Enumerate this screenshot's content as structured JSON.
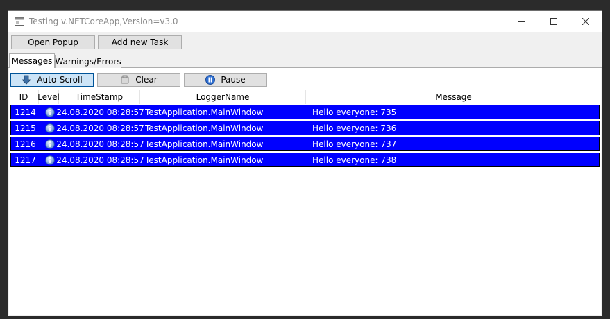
{
  "window": {
    "title": "Testing v.NETCoreApp,Version=v3.0"
  },
  "topbar": {
    "open_popup": "Open Popup",
    "add_task": "Add new Task"
  },
  "tabs": [
    {
      "label": "Messages",
      "active": true
    },
    {
      "label": "Warnings/Errors",
      "active": false
    }
  ],
  "toolbar": {
    "autoscroll": "Auto-Scroll",
    "clear": "Clear",
    "pause": "Pause"
  },
  "table": {
    "columns": [
      "ID",
      "Level",
      "TimeStamp",
      "LoggerName",
      "Message"
    ],
    "rows": [
      {
        "id": "1214",
        "level": "info-icon",
        "timestamp": "24.08.2020 08:28:57",
        "logger": "TestApplication.MainWindow",
        "message": "Hello everyone: 735"
      },
      {
        "id": "1215",
        "level": "info-icon",
        "timestamp": "24.08.2020 08:28:57",
        "logger": "TestApplication.MainWindow",
        "message": "Hello everyone: 736"
      },
      {
        "id": "1216",
        "level": "info-icon",
        "timestamp": "24.08.2020 08:28:57",
        "logger": "TestApplication.MainWindow",
        "message": "Hello everyone: 737"
      },
      {
        "id": "1217",
        "level": "info-icon",
        "timestamp": "24.08.2020 08:28:57",
        "logger": "TestApplication.MainWindow",
        "message": "Hello everyone: 738"
      }
    ]
  },
  "colors": {
    "selected_row": "#0000ff",
    "pressed_button": "#cce4f7"
  }
}
